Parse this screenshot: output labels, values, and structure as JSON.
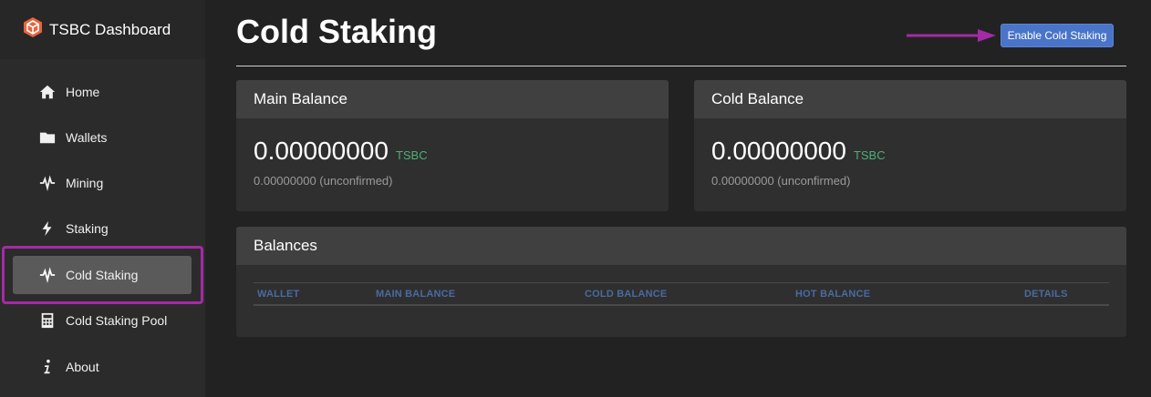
{
  "app": {
    "title": "TSBC Dashboard"
  },
  "sidebar": {
    "items": [
      {
        "label": "Home",
        "icon": "home-icon"
      },
      {
        "label": "Wallets",
        "icon": "folder-icon"
      },
      {
        "label": "Mining",
        "icon": "pulse-icon"
      },
      {
        "label": "Staking",
        "icon": "bolt-icon"
      },
      {
        "label": "Cold Staking",
        "icon": "pulse-icon",
        "active": true
      },
      {
        "label": "Cold Staking Pool",
        "icon": "calculator-icon"
      },
      {
        "label": "About",
        "icon": "info-icon"
      }
    ]
  },
  "page": {
    "title": "Cold Staking",
    "enable_button": "Enable Cold Staking"
  },
  "main_balance": {
    "title": "Main Balance",
    "value": "0.00000000",
    "unit": "TSBC",
    "unconfirmed": "0.00000000 (unconfirmed)"
  },
  "cold_balance": {
    "title": "Cold Balance",
    "value": "0.00000000",
    "unit": "TSBC",
    "unconfirmed": "0.00000000 (unconfirmed)"
  },
  "balances": {
    "title": "Balances",
    "columns": [
      "WALLET",
      "MAIN BALANCE",
      "COLD BALANCE",
      "HOT BALANCE",
      "DETAILS"
    ]
  },
  "colors": {
    "accent": "#4a74c9",
    "highlight": "#a52aa6",
    "unit": "#4caf7a",
    "column_header": "#4a6aa0"
  }
}
